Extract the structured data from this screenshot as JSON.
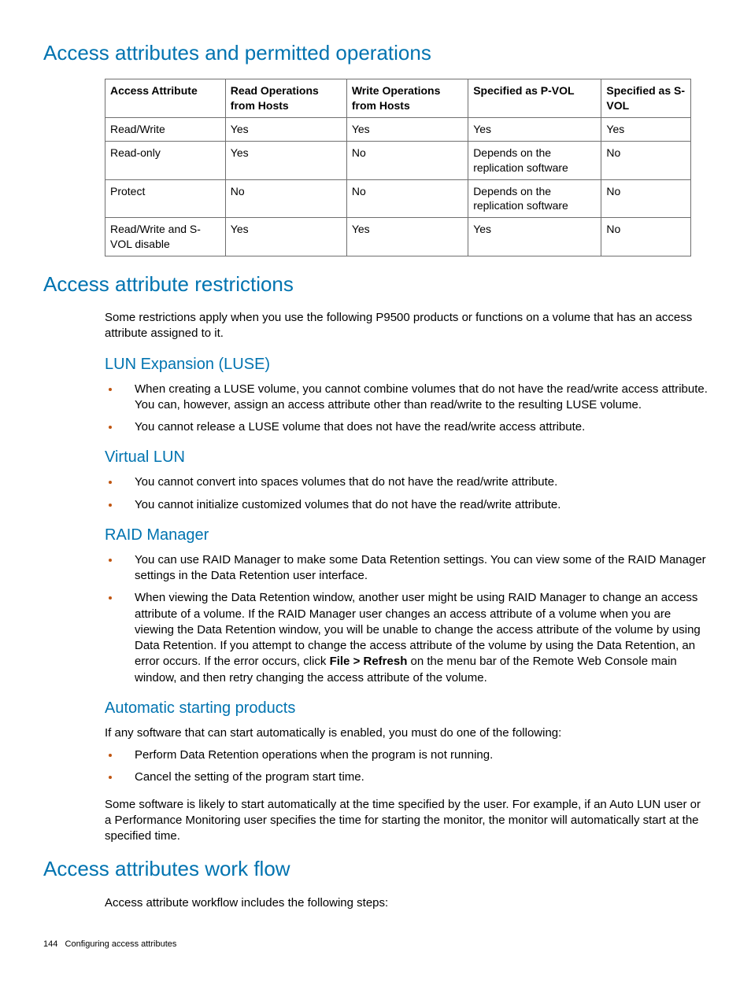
{
  "headings": {
    "h1a": "Access attributes and permitted operations",
    "h1b": "Access attribute restrictions",
    "h1c": "Access attributes work flow",
    "luse": "LUN Expansion (LUSE)",
    "vlun": "Virtual LUN",
    "raid": "RAID Manager",
    "auto": "Automatic starting products"
  },
  "table": {
    "headers": {
      "c0": "Access Attribute",
      "c1": "Read Operations from Hosts",
      "c2": "Write Operations from Hosts",
      "c3": "Specified as P-VOL",
      "c4": "Specified as S-VOL"
    },
    "rows": [
      {
        "c0": "Read/Write",
        "c1": "Yes",
        "c2": "Yes",
        "c3": "Yes",
        "c4": "Yes"
      },
      {
        "c0": "Read-only",
        "c1": "Yes",
        "c2": "No",
        "c3": "Depends on the replication software",
        "c4": "No"
      },
      {
        "c0": "Protect",
        "c1": "No",
        "c2": "No",
        "c3": "Depends on the replication software",
        "c4": "No"
      },
      {
        "c0": "Read/Write and S-VOL disable",
        "c1": "Yes",
        "c2": "Yes",
        "c3": "Yes",
        "c4": "No"
      }
    ]
  },
  "para": {
    "restrictions_intro": "Some restrictions apply when you use the following P9500 products or functions on a volume that has an access attribute assigned to it.",
    "luse1": "When creating a LUSE volume, you cannot combine volumes that do not have the read/write access attribute. You can, however, assign an access attribute other than read/write to the resulting LUSE volume.",
    "luse2": "You cannot release a LUSE volume that does not have the read/write access attribute.",
    "vlun1": "You cannot convert into spaces volumes that do not have the read/write attribute.",
    "vlun2": "You cannot initialize customized volumes that do not have the read/write attribute.",
    "raid1": "You can use RAID Manager to make some Data Retention settings. You can view some of the RAID Manager settings in the Data Retention user interface.",
    "raid2a": "When viewing the Data Retention window, another user might be using RAID Manager to change an access attribute of a volume. If the RAID Manager user changes an access attribute of a volume when you are viewing the Data Retention window, you will be unable to change the access attribute of the volume by using Data Retention. If you attempt to change the access attribute of the volume by using the Data Retention, an error occurs. If the error occurs, click ",
    "raid2bold": "File > Refresh",
    "raid2b": " on the menu bar of the Remote Web Console main window, and then retry changing the access attribute of the volume.",
    "auto_intro": "If any software that can start automatically is enabled, you must do one of the following:",
    "auto1": "Perform Data Retention operations when the program is not running.",
    "auto2": "Cancel the setting of the program start time.",
    "auto_outro": "Some software is likely to start automatically at the time specified by the user. For example, if an Auto LUN user or a Performance Monitoring user specifies the time for starting the monitor, the monitor will automatically start at the specified time.",
    "workflow": "Access attribute workflow includes the following steps:"
  },
  "footer": {
    "page": "144",
    "title": "Configuring access attributes"
  }
}
